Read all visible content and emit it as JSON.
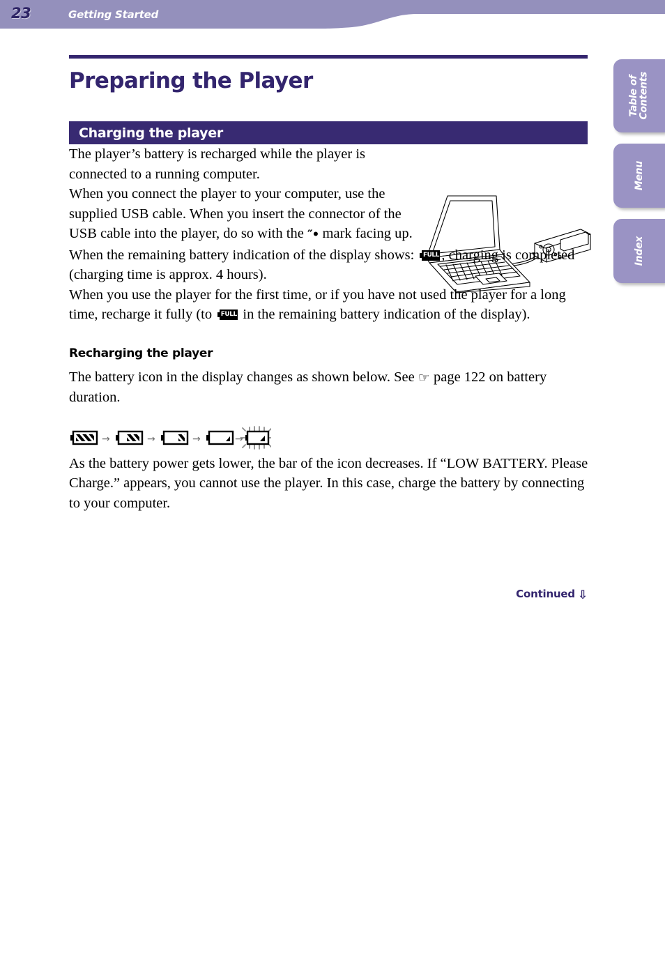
{
  "header": {
    "page_number": "23",
    "section_title": "Getting Started",
    "band_color": "#9490bc"
  },
  "side_tabs": [
    {
      "label": "Table of\nContents",
      "name": "table-of-contents"
    },
    {
      "label": "Menu",
      "name": "menu"
    },
    {
      "label": "Index",
      "name": "index"
    }
  ],
  "main": {
    "title": "Preparing the Player",
    "title_color": "#33256e",
    "section_heading": "Charging the player",
    "section_heading_bg": "#382a72",
    "paragraph_1_a": "The player’s battery is recharged while the player is connected to a running computer.",
    "paragraph_1_b": "When you connect the player to your computer, use the supplied USB cable. When you insert the connector of the USB cable into the player, do so with the ",
    "paragraph_1_c": " mark facing up.",
    "walkman_mark": "″•",
    "paragraph_2_a": "When the remaining battery indication of the display shows: ",
    "paragraph_2_b": ", charging is completed (charging time is approx. 4 hours).",
    "paragraph_3_a": "When you use the player for the first time, or if you have not used the player for a long time, recharge it fully (to ",
    "paragraph_3_b": " in the remaining battery indication of the display).",
    "full_icon_label": "FULL",
    "subheading": "Recharging the player",
    "paragraph_4_a": "The battery icon in the display changes as shown below. See ",
    "hand_icon": "☞",
    "paragraph_4_b": " page 122 on battery duration.",
    "paragraph_5": "As the battery power gets lower, the bar of the icon decreases. If “LOW BATTERY. Please Charge.” appears, you cannot use the player. In this case, charge the battery by connecting to your computer.",
    "continued_label": "Continued",
    "continued_arrow": "⇩"
  },
  "battery_sequence": {
    "states": [
      {
        "name": "battery-full",
        "bars": 3,
        "flashing": false
      },
      {
        "name": "battery-high",
        "bars": 2,
        "flashing": false
      },
      {
        "name": "battery-medium",
        "bars": 1,
        "flashing": false
      },
      {
        "name": "battery-low",
        "bars": 0,
        "flashing": false
      },
      {
        "name": "battery-empty-flashing",
        "bars": 0,
        "flashing": true
      }
    ],
    "separator": "→"
  },
  "illustration": {
    "name": "laptop-connected-to-player",
    "description": "Line drawing of a notebook computer connected by a USB cable to a portable media player"
  }
}
